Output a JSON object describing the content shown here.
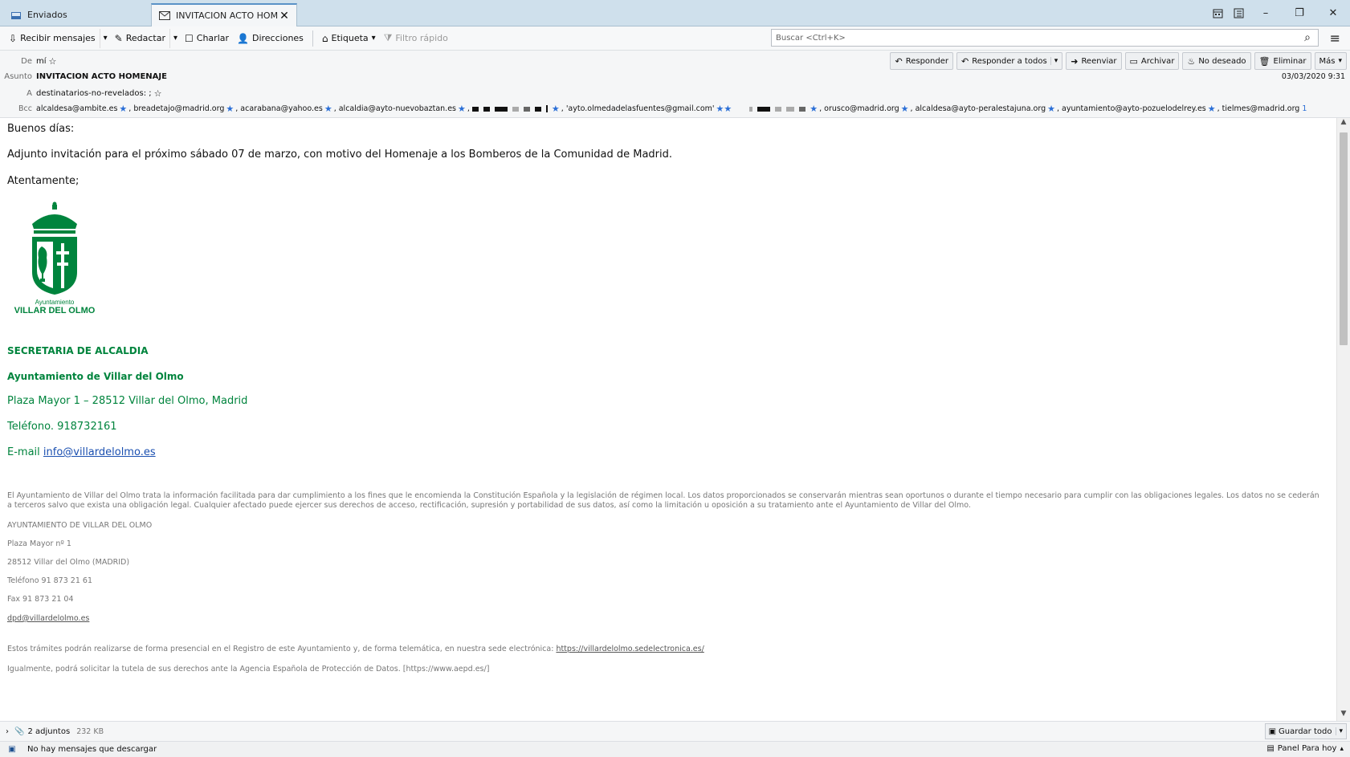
{
  "tabs": [
    {
      "label": "Enviados",
      "icon": "folder-sent-icon"
    },
    {
      "label": "INVITACION ACTO HOMENAJE",
      "icon": "envelope-icon"
    }
  ],
  "window_controls": {
    "calendar": "calendar-icon",
    "tasks": "tasks-icon",
    "minimize": "–",
    "restore": "❐",
    "close": "✕"
  },
  "toolbar": {
    "get_messages": "Recibir mensajes",
    "compose": "Redactar",
    "chat": "Charlar",
    "address_book": "Direcciones",
    "tag": "Etiqueta",
    "quick_filter": "Filtro rápido",
    "search_placeholder": "Buscar <Ctrl+K>"
  },
  "header": {
    "from_label": "De",
    "from_value": "mí",
    "subject_label": "Asunto",
    "subject_value": "INVITACION ACTO HOMENAJE",
    "to_label": "A",
    "to_value": "destinatarios-no-revelados: ;",
    "bcc_label": "Bcc",
    "bcc": [
      "alcaldesa@ambite.es",
      "breadetajo@madrid.org",
      "acarabana@yahoo.es",
      "alcaldia@ayto-nuevobaztan.es",
      "'ayto.olmedadelasfuentes@gmail.com'",
      "orusco@madrid.org",
      "alcaldesa@ayto-perale­stajuna.org",
      "ayuntamiento@ayto-pozuelodelrey.es",
      "tielmes@madrid.org"
    ],
    "bcc_more": "1",
    "date": "03/03/2020 9:31",
    "actions": {
      "reply": "Responder",
      "reply_all": "Responder a todos",
      "forward": "Reenviar",
      "archive": "Archivar",
      "junk": "No deseado",
      "delete": "Eliminar",
      "more": "Más"
    }
  },
  "body": {
    "greeting": "Buenos días:",
    "paragraph": "Adjunto invitación para el próximo sábado 07 de marzo, con motivo del Homenaje a los Bomberos de la Comunidad de Madrid.",
    "closing": "Atentamente;",
    "logo_text_1": "Ayuntamiento",
    "logo_text_2": "VILLAR DEL OLMO",
    "sig_dept": "SECRETARIA DE ALCALDIA",
    "sig_org": "Ayuntamiento de Villar del Olmo",
    "sig_address": "Plaza Mayor 1 – 28512 Villar del Olmo, Madrid",
    "sig_phone": "Teléfono. 918732161",
    "sig_email_label": "E-mail ",
    "sig_email": "info@villardelolmo.es",
    "legal_1": "El Ayuntamiento de Villar del Olmo trata la información facilitada para dar cumplimiento a los fines que le encomienda la Constitución Española y la legislación de régimen local. Los datos proporcionados se conservarán mientras sean oportunos o durante el tiempo necesario para cumplir con las obligaciones legales. Los datos no se cederán a terceros salvo que exista una obligación legal. Cualquier afectado puede ejercer sus derechos de acceso, rectificación, supresión y portabilidad de sus datos, así como la limitación u oposición a su tratamiento ante el Ayuntamiento de Villar del Olmo.",
    "legal_org": "AYUNTAMIENTO DE VILLAR DEL OLMO",
    "legal_addr": "Plaza Mayor nº 1",
    "legal_city": "28512 Villar del Olmo (MADRID)",
    "legal_phone": "Teléfono 91 873 21 61",
    "legal_fax": "Fax 91 873 21 04",
    "legal_dpd": "dpd@villardelolmo.es",
    "legal_tramites": "Estos trámites podrán realizarse de forma presencial en el Registro de este Ayuntamiento y, de forma telemática, en nuestra sede electrónica: ",
    "legal_sede": "https://villardelolmo.sedelectronica.es/",
    "legal_aepd": "Igualmente, podrá solicitar la tutela de sus derechos ante la Agencia Española de Protección de Datos. [https://www.aepd.es/]"
  },
  "attachments": {
    "label": "2 adjuntos",
    "size": "232 KB",
    "save_all": "Guardar todo"
  },
  "status": {
    "text": "No hay mensajes que descargar",
    "today_pane": "Panel Para hoy"
  },
  "colors": {
    "green": "#00843d",
    "link": "#1a4fb0",
    "star": "#2a6ed6",
    "tabbar": "#cfe0ec"
  }
}
